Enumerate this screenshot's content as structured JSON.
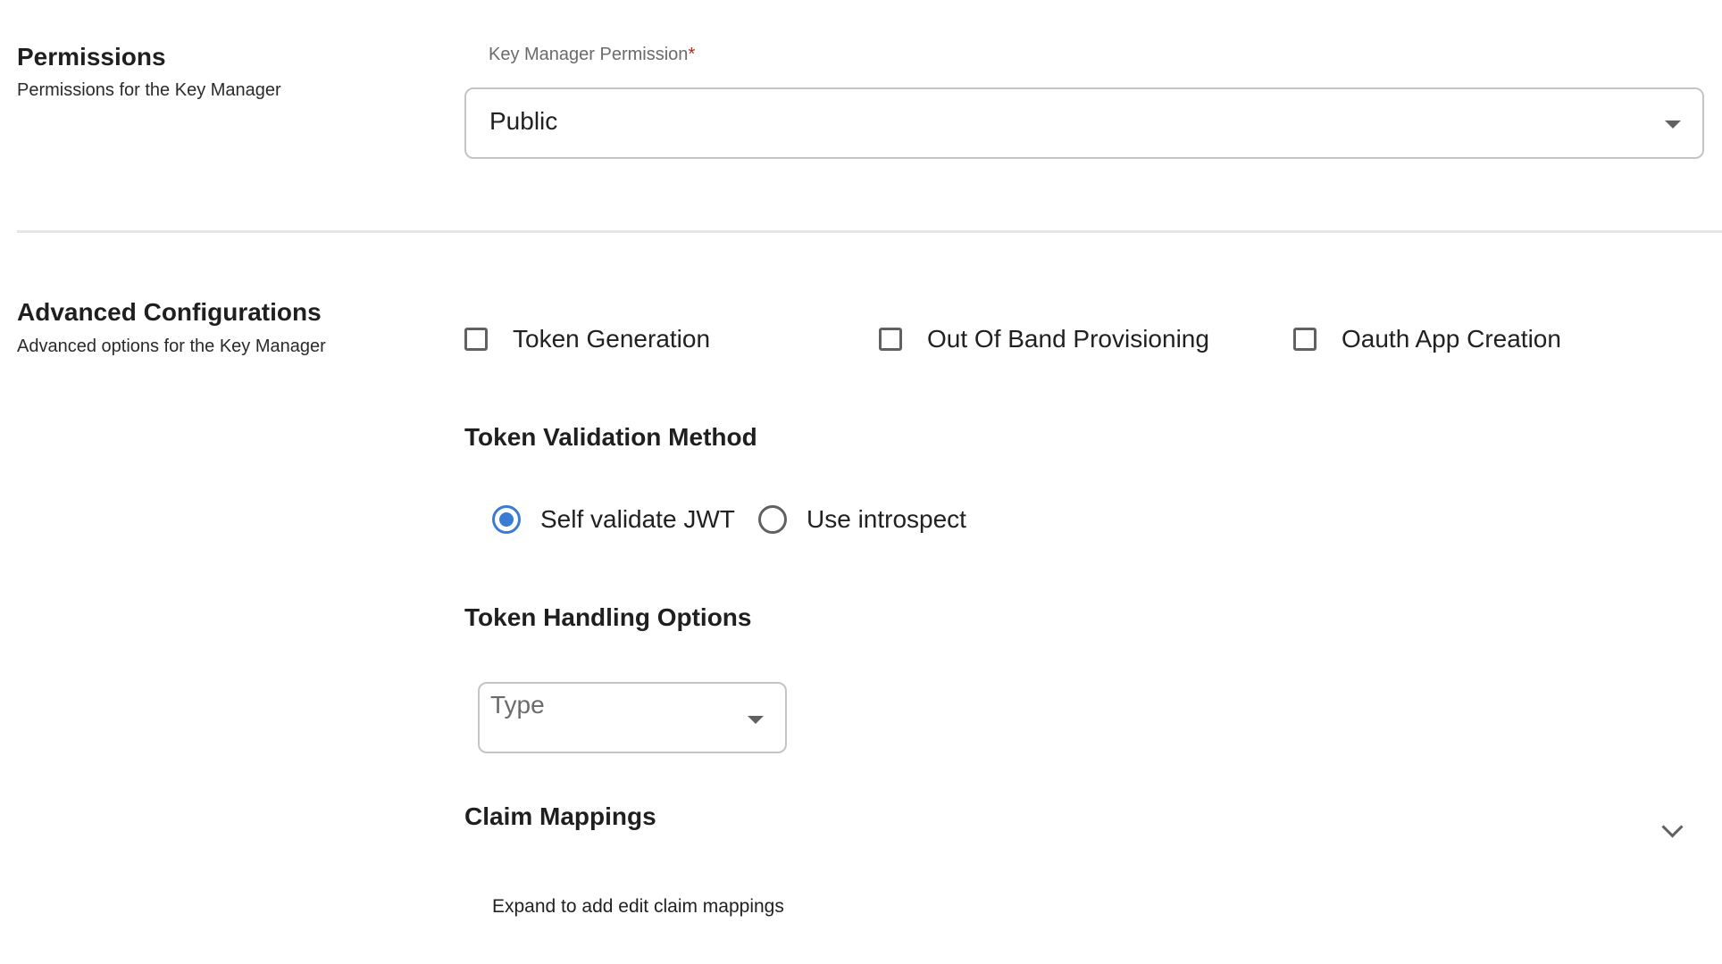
{
  "permissions": {
    "title": "Permissions",
    "description": "Permissions for the Key Manager",
    "field_label": "Key Manager Permission",
    "required_mark": "*",
    "selected_value": "Public"
  },
  "advanced": {
    "title": "Advanced Configurations",
    "description": "Advanced options for the Key Manager",
    "checkboxes": [
      {
        "label": "Token Generation",
        "checked": false
      },
      {
        "label": "Out Of Band Provisioning",
        "checked": false
      },
      {
        "label": "Oauth App Creation",
        "checked": false
      }
    ],
    "token_validation": {
      "heading": "Token Validation Method",
      "options": [
        {
          "label": "Self validate JWT",
          "selected": true
        },
        {
          "label": "Use introspect",
          "selected": false
        }
      ]
    },
    "token_handling": {
      "heading": "Token Handling Options",
      "type_placeholder": "Type"
    },
    "claim_mappings": {
      "heading": "Claim Mappings",
      "description": "Expand to add edit claim mappings",
      "expand_icon": "chevron-down-icon"
    }
  },
  "colors": {
    "accent": "#3a7bd5",
    "required": "#b3261e",
    "border": "#c4c4c4",
    "divider": "#e6e6e6"
  }
}
